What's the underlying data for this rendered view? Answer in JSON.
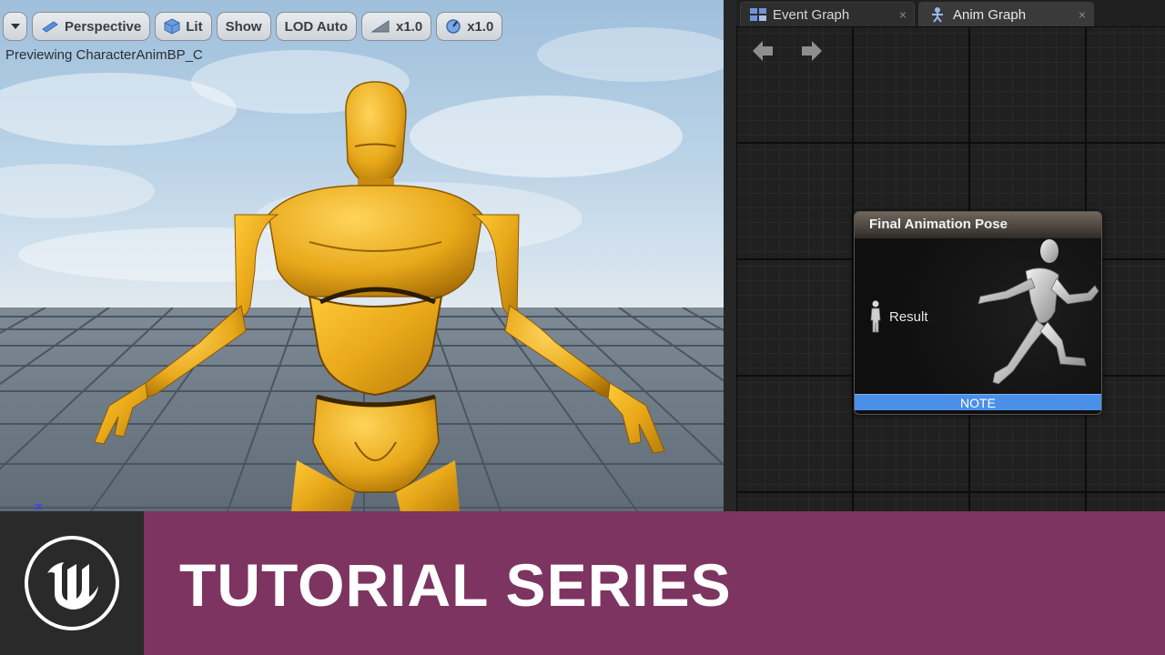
{
  "viewport": {
    "toolbar": {
      "dropdown_icon": "chevron-down-icon",
      "perspective_label": "Perspective",
      "lit_label": "Lit",
      "show_label": "Show",
      "lod_label": "LOD Auto",
      "play_rate_label": "x1.0",
      "speed_label": "x1.0"
    },
    "preview_text": "Previewing CharacterAnimBP_C",
    "character_color": "#e8a81a"
  },
  "graph": {
    "tabs": [
      {
        "label": "Event Graph",
        "close": "×",
        "icon": "event-graph-icon"
      },
      {
        "label": "Anim Graph",
        "close": "×",
        "icon": "anim-graph-icon"
      }
    ],
    "nav": {
      "back_icon": "arrow-left-icon",
      "forward_icon": "arrow-right-icon"
    },
    "node": {
      "title": "Final Animation Pose",
      "pin_label": "Result",
      "pin_icon": "pose-pin-icon",
      "note_label": "NOTE",
      "note_color": "#4a90e8"
    }
  },
  "banner": {
    "title": "TUTORIAL SERIES",
    "logo": "unreal-engine-logo",
    "color": "#7d3460"
  }
}
